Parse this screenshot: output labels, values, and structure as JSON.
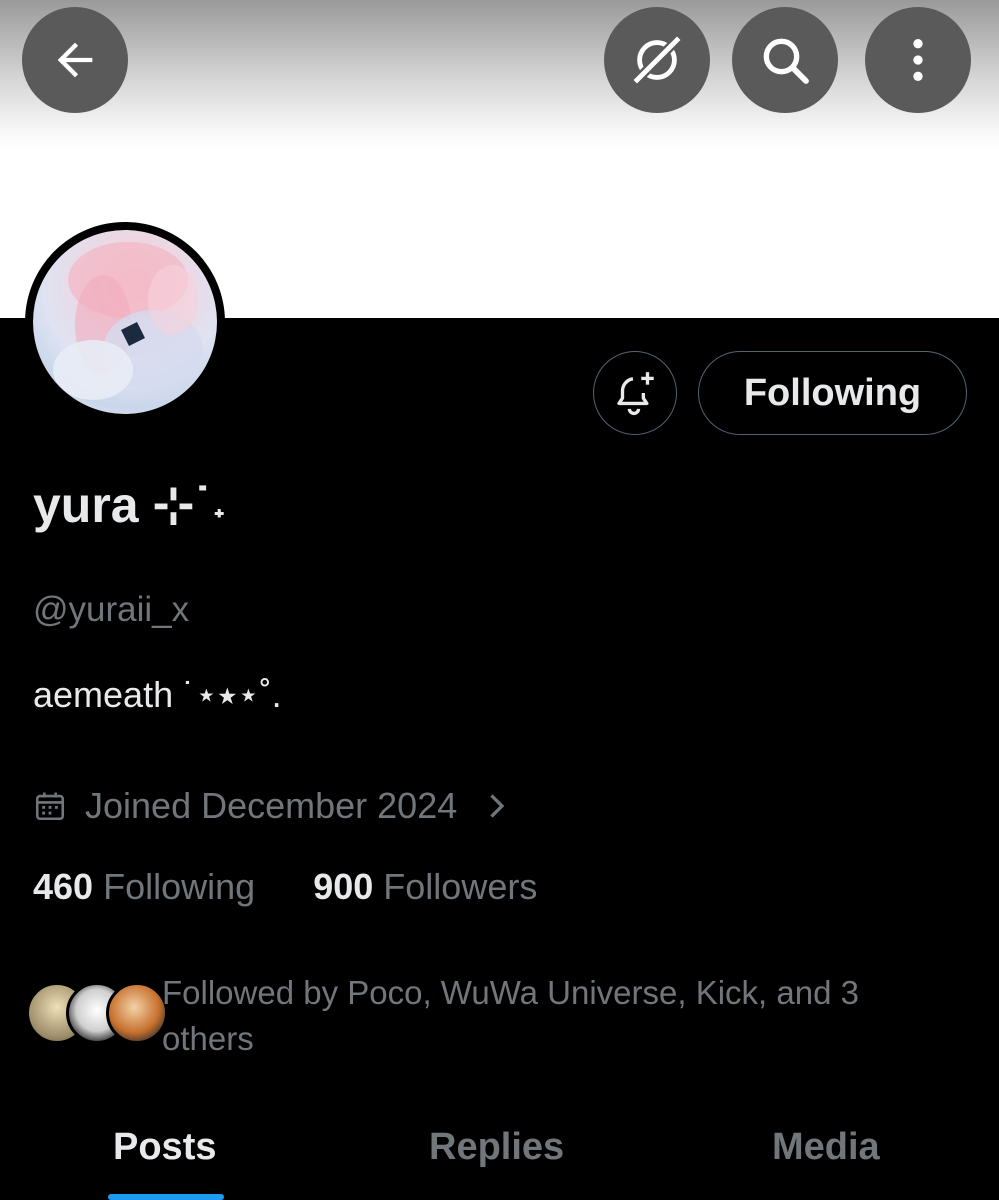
{
  "header": {
    "back_icon": "arrow-left-icon",
    "grok_icon": "grok-icon",
    "search_icon": "search-icon",
    "more_icon": "more-vertical-icon"
  },
  "profile": {
    "name": "yura ⊹˙˖",
    "handle": "@yuraii_x",
    "bio": "aemeath ˙⋆⭑⋆˚.",
    "joined": "Joined December 2024",
    "following_count": "460",
    "following_label": "Following",
    "followers_count": "900",
    "followers_label": "Followers"
  },
  "actions": {
    "notify_icon": "bell-plus-icon",
    "following_button": "Following"
  },
  "followed_by": {
    "text": "Followed by Poco, WuWa Universe, Kick, and 3 others"
  },
  "tabs": [
    {
      "label": "Posts",
      "active": true
    },
    {
      "label": "Replies",
      "active": false
    },
    {
      "label": "Media",
      "active": false
    }
  ],
  "colors": {
    "background": "#000000",
    "text_primary": "#e7e9ea",
    "text_secondary": "#71767b",
    "border": "#536471",
    "accent": "#1d9bf0",
    "header_button": "#5a5a5a"
  }
}
